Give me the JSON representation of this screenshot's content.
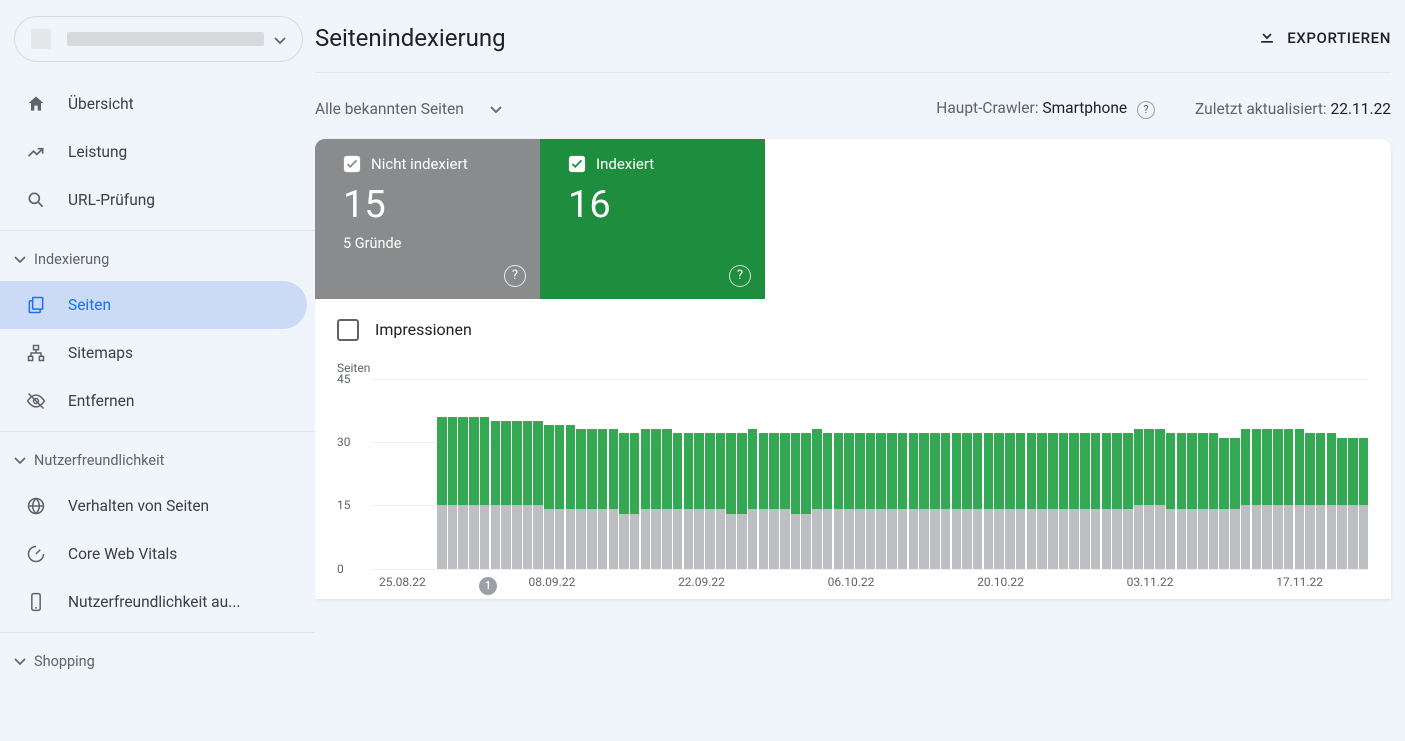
{
  "property": {
    "label": ""
  },
  "sidebar": {
    "items": [
      {
        "label": "Übersicht",
        "icon": "home"
      },
      {
        "label": "Leistung",
        "icon": "trending"
      },
      {
        "label": "URL-Prüfung",
        "icon": "search"
      }
    ],
    "section_index": {
      "label": "Indexierung"
    },
    "index_items": [
      {
        "label": "Seiten",
        "icon": "pages",
        "active": true
      },
      {
        "label": "Sitemaps",
        "icon": "sitemap"
      },
      {
        "label": "Entfernen",
        "icon": "hide"
      }
    ],
    "section_ux": {
      "label": "Nutzerfreundlichkeit"
    },
    "ux_items": [
      {
        "label": "Verhalten von Seiten",
        "icon": "globe"
      },
      {
        "label": "Core Web Vitals",
        "icon": "speed"
      },
      {
        "label": "Nutzerfreundlichkeit au...",
        "icon": "phone"
      }
    ],
    "section_shopping": {
      "label": "Shopping"
    }
  },
  "header": {
    "title": "Seitenindexierung",
    "export": "EXPORTIEREN"
  },
  "meta": {
    "dropdown": "Alle bekannten Seiten",
    "crawler_label": "Haupt-Crawler:",
    "crawler_value": "Smartphone",
    "updated_label": "Zuletzt aktualisiert:",
    "updated_value": "22.11.22"
  },
  "tiles": {
    "not_indexed": {
      "label": "Nicht indexiert",
      "value": "15",
      "sub": "5 Gründe"
    },
    "indexed": {
      "label": "Indexiert",
      "value": "16"
    }
  },
  "impressions_label": "Impressionen",
  "chart_ylabel": "Seiten",
  "chart_annotation": "1",
  "chart_data": {
    "type": "bar",
    "ylabel": "Seiten",
    "ylim": [
      0,
      45
    ],
    "y_ticks": [
      0,
      15,
      30,
      45
    ],
    "x_ticks": [
      "25.08.22",
      "08.09.22",
      "22.09.22",
      "06.10.22",
      "20.10.22",
      "03.11.22",
      "17.11.22"
    ],
    "stack_names": [
      "Indexiert",
      "Nicht indexiert"
    ],
    "stack_colors": [
      "#34a853",
      "#bdbfc2"
    ],
    "categories_start": "28.08.22",
    "note": "Daily stacked bars; values estimated from gridlines",
    "series": [
      {
        "name": "Indexiert",
        "values": [
          21,
          21,
          21,
          21,
          21,
          20,
          20,
          20,
          20,
          20,
          20,
          20,
          20,
          19,
          19,
          19,
          19,
          19,
          19,
          19,
          19,
          19,
          18,
          18,
          18,
          18,
          18,
          19,
          19,
          19,
          18,
          18,
          18,
          19,
          19,
          19,
          18,
          18,
          18,
          18,
          18,
          18,
          18,
          18,
          18,
          18,
          18,
          18,
          18,
          18,
          18,
          18,
          18,
          18,
          18,
          18,
          18,
          18,
          18,
          18,
          18,
          18,
          18,
          18,
          18,
          18,
          18,
          18,
          18,
          18,
          18,
          18,
          18,
          17,
          17,
          18,
          18,
          18,
          18,
          18,
          18,
          17,
          17,
          17,
          16,
          16,
          16
        ]
      },
      {
        "name": "Nicht indexiert",
        "values": [
          15,
          15,
          15,
          15,
          15,
          15,
          15,
          15,
          15,
          15,
          14,
          14,
          14,
          14,
          14,
          14,
          14,
          13,
          13,
          14,
          14,
          14,
          14,
          14,
          14,
          14,
          14,
          13,
          13,
          14,
          14,
          14,
          14,
          13,
          13,
          14,
          14,
          14,
          14,
          14,
          14,
          14,
          14,
          14,
          14,
          14,
          14,
          14,
          14,
          14,
          14,
          14,
          14,
          14,
          14,
          14,
          14,
          14,
          14,
          14,
          14,
          14,
          14,
          14,
          14,
          15,
          15,
          15,
          14,
          14,
          14,
          14,
          14,
          14,
          14,
          15,
          15,
          15,
          15,
          15,
          15,
          15,
          15,
          15,
          15,
          15,
          15
        ]
      }
    ],
    "annotation_index": 4
  }
}
